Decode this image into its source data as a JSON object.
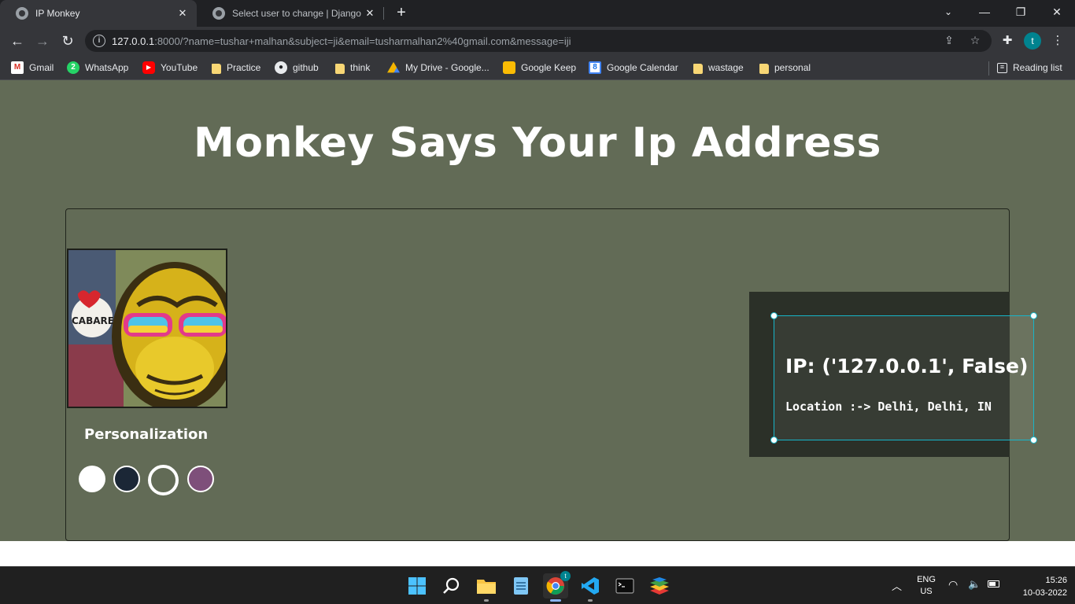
{
  "browser": {
    "tabs": [
      {
        "title": "IP Monkey",
        "active": true
      },
      {
        "title": "Select user to change | Django sit",
        "active": false
      }
    ],
    "url": {
      "host": "127.0.0.1",
      "rest": ":8000/?name=tushar+malhan&subject=ji&email=tusharmalhan2%40gmail.com&message=iji"
    },
    "profile_initial": "t",
    "bookmarks": [
      {
        "label": "Gmail",
        "icon": "gmail-icon"
      },
      {
        "label": "WhatsApp",
        "icon": "whatsapp-icon",
        "badge": "2"
      },
      {
        "label": "YouTube",
        "icon": "youtube-icon"
      },
      {
        "label": "Practice",
        "icon": "folder-icon"
      },
      {
        "label": "github",
        "icon": "github-icon"
      },
      {
        "label": "think",
        "icon": "folder-icon"
      },
      {
        "label": "My Drive - Google...",
        "icon": "google-drive-icon"
      },
      {
        "label": "Google Keep",
        "icon": "google-keep-icon"
      },
      {
        "label": "Google Calendar",
        "icon": "google-calendar-icon",
        "badge": "8"
      },
      {
        "label": "wastage",
        "icon": "folder-icon"
      },
      {
        "label": "personal",
        "icon": "folder-icon"
      }
    ],
    "reading_list": "Reading list"
  },
  "page": {
    "heading": "Monkey Says Your Ip Address",
    "personalization": "Personalization",
    "swatches": [
      "#ffffff",
      "#1b2736",
      "#626b56",
      "#7e4f7a"
    ],
    "ip_line": "IP: ('127.0.0.1', False)",
    "location_line": "Location :-> Delhi, Delhi, IN",
    "graffiti_text": "CABARETE Beach"
  },
  "taskbar": {
    "language": "ENG",
    "region": "US",
    "time": "15:26",
    "date": "10-03-2022",
    "chrome_badge": "t"
  },
  "colors": {
    "page_bg": "#626b56",
    "panel_bg": "#2b3028",
    "selection_accent": "#17b5c9",
    "chrome_dark": "#202124",
    "chrome_toolbar": "#35363a"
  }
}
